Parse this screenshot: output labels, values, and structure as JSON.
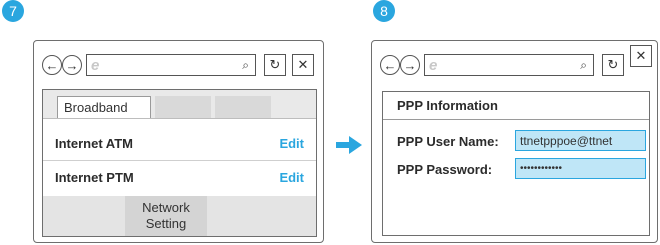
{
  "steps": [
    {
      "number": "7"
    },
    {
      "number": "8"
    }
  ],
  "toolbar": {
    "back_glyph": "←",
    "forward_glyph": "→",
    "browser_icon": "e",
    "search_glyph": "⌕",
    "refresh_glyph": "↻",
    "close_glyph": "✕"
  },
  "left_panel": {
    "tabs": [
      {
        "label": "Broadband"
      },
      {
        "label": ""
      },
      {
        "label": ""
      }
    ],
    "rows": [
      {
        "label": "Internet ATM",
        "action": "Edit"
      },
      {
        "label": "Internet PTM",
        "action": "Edit"
      }
    ],
    "footer_button": {
      "line1": "Network",
      "line2": "Setting"
    }
  },
  "right_panel": {
    "title": "PPP Information",
    "fields": [
      {
        "label": "PPP User Name:",
        "value": "ttnetpppoe@ttnet"
      },
      {
        "label": "PPP Password:",
        "value": "••••••••••••"
      }
    ]
  },
  "colors": {
    "accent": "#2aa6df",
    "input_fill": "#bfe6f7"
  }
}
